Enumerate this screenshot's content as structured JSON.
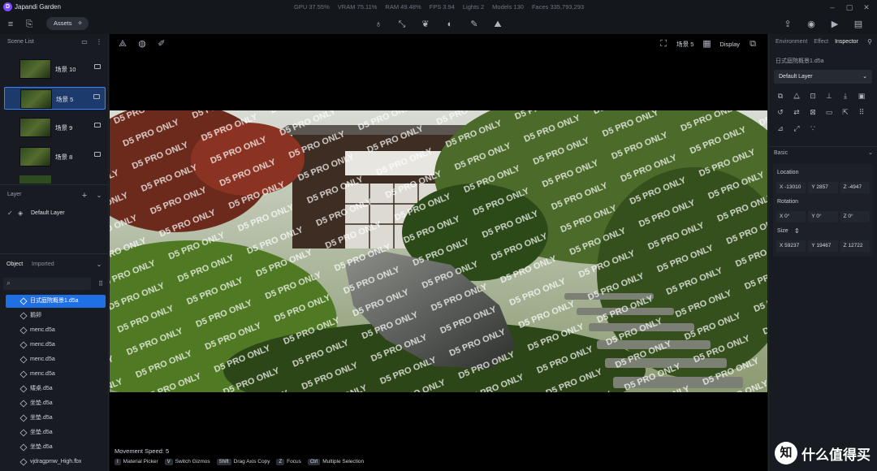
{
  "titlebar": {
    "logo": "D",
    "title": "Japandi Garden",
    "stats": [
      "GPU 37.55%",
      "VRAM 75.11%",
      "RAM 49.48%",
      "FPS 3.94",
      "Lights 2",
      "Models 130",
      "Faces 335,793,293"
    ]
  },
  "toolbar": {
    "assets_label": "Assets"
  },
  "scene_list": {
    "header": "Scene List",
    "items": [
      {
        "label": "场景 10",
        "selected": false
      },
      {
        "label": "场景 5",
        "selected": true
      },
      {
        "label": "场景 9",
        "selected": false
      },
      {
        "label": "场景 8",
        "selected": false
      }
    ]
  },
  "layer_panel": {
    "header": "Layer",
    "default_layer": "Default Layer"
  },
  "object_panel": {
    "tabs": [
      "Object",
      "Imported"
    ],
    "items": [
      "日式庭院概景1.d5a",
      "鹅卵",
      "menc.d5a",
      "menc.d5a",
      "menc.d5a",
      "menc.d5a",
      "矮桌.d5a",
      "坐垫.d5a",
      "坐垫.d5a",
      "坐垫.d5a",
      "坐垫.d5a",
      "vjdragpmw_High.fbx"
    ]
  },
  "viewport": {
    "scene_name": "场景 5",
    "display_label": "Display",
    "watermark_text": "D5 PRO ONLY",
    "movement_speed": "Movement Speed: 5",
    "shortcuts": [
      {
        "key": "I",
        "label": "Material Picker"
      },
      {
        "key": "V",
        "label": "Switch Gizmos"
      },
      {
        "key": "Shift",
        "label": "Drag Axis Copy"
      },
      {
        "key": "Z",
        "label": "Focus"
      },
      {
        "key": "Ctrl",
        "label": "Multiple Selection"
      }
    ]
  },
  "right_panel": {
    "tabs": [
      "Environment",
      "Effect",
      "Inspector"
    ],
    "active_tab": "Inspector",
    "object_name": "日式庭院概景1.d5a",
    "layer_select": "Default Layer",
    "basic_header": "Basic",
    "location_label": "Location",
    "location": [
      "X -13010",
      "Y 2857",
      "Z -4947"
    ],
    "rotation_label": "Rotation",
    "rotation": [
      "X 0°",
      "Y 0°",
      "Z 0°"
    ],
    "size_label": "Size",
    "size": [
      "X 59237",
      "Y 19467",
      "Z 12722"
    ]
  },
  "zhihu": {
    "logo": "知",
    "text": "什么值得买"
  }
}
